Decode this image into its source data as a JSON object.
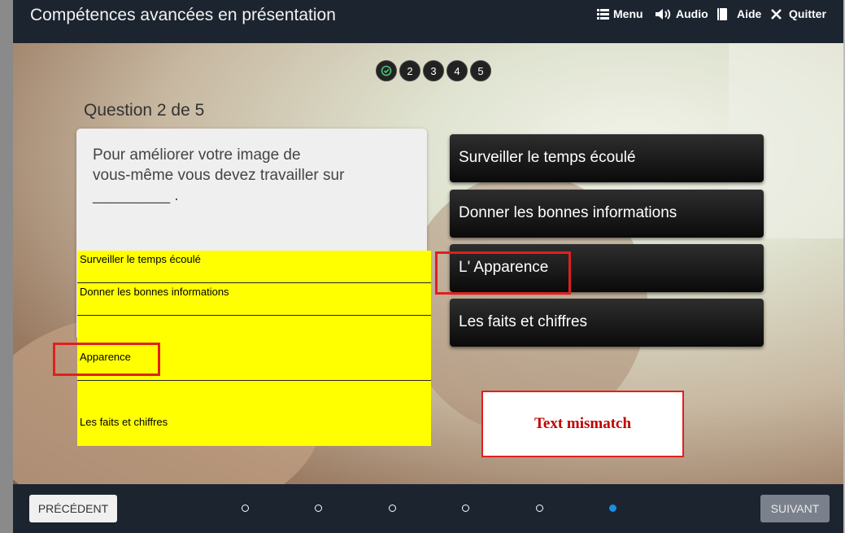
{
  "header": {
    "title": "Compétences avancées en présentation",
    "menu_label": "Menu",
    "audio_label": "Audio",
    "help_label": "Aide",
    "quit_label": "Quitter"
  },
  "progress": {
    "steps": [
      "2",
      "3",
      "4",
      "5"
    ],
    "completed_icon": "check-circle-icon"
  },
  "question": {
    "label": "Question 2 de 5",
    "text_line1": "Pour améliorer votre image de",
    "text_line2": "vous-même vous devez travailler sur",
    "text_line3": "_________ ."
  },
  "answer_table": {
    "rows": [
      "Surveiller le temps écoulé",
      "Donner les bonnes informations",
      "Apparence",
      "Les faits et chiffres"
    ]
  },
  "choices": [
    "Surveiller le temps écoulé",
    "Donner les bonnes informations",
    "L' Apparence",
    "Les faits et chiffres"
  ],
  "annotation": {
    "mismatch_text": "Text mismatch",
    "color": "#e02020"
  },
  "footer": {
    "prev_label": "PRÉCÉDENT",
    "next_label": "SUIVANT",
    "page_dots": 6,
    "active_dot": 6
  },
  "colors": {
    "bar_bg": "#1c2430",
    "answer_highlight": "#ffff00",
    "active_dot": "#1b8ee6"
  }
}
